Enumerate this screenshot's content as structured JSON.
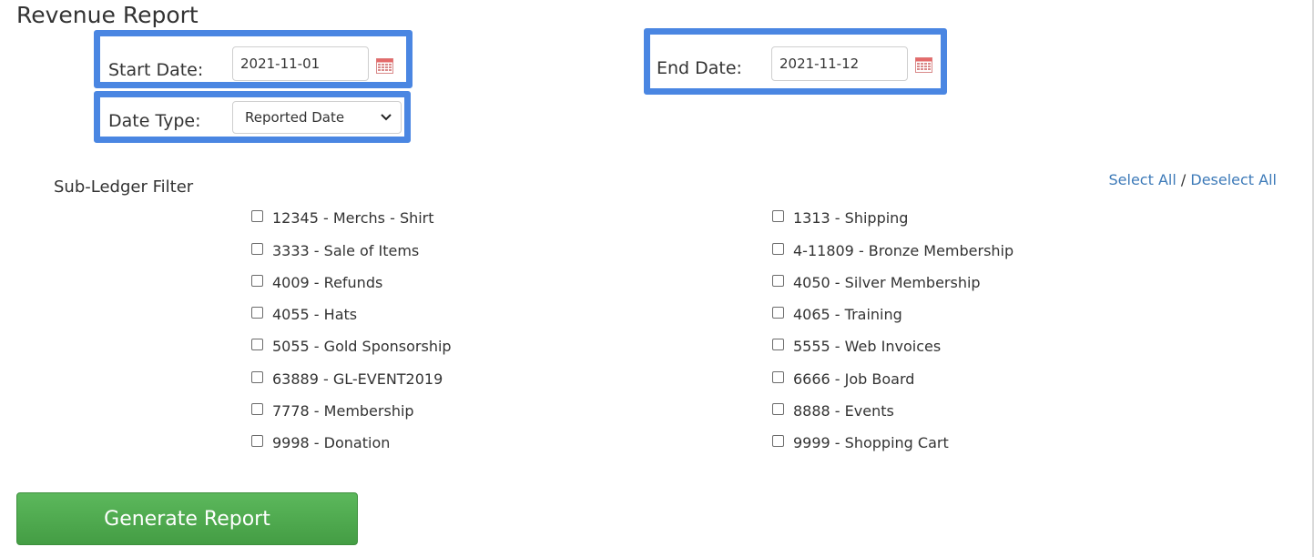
{
  "page": {
    "title": "Revenue Report"
  },
  "filters": {
    "start_date": {
      "label": "Start Date:",
      "value": "2021-11-01"
    },
    "end_date": {
      "label": "End Date:",
      "value": "2021-11-12"
    },
    "date_type": {
      "label": "Date Type:",
      "selected": "Reported Date"
    }
  },
  "subledger": {
    "title": "Sub-Ledger Filter",
    "select_all": "Select All",
    "separator": "/",
    "deselect_all": "Deselect All",
    "left": [
      "12345 - Merchs - Shirt",
      "3333 - Sale of Items",
      "4009 - Refunds",
      "4055 - Hats",
      "5055 - Gold Sponsorship",
      "63889 - GL-EVENT2019",
      "7778 - Membership",
      "9998 - Donation"
    ],
    "right": [
      "1313 - Shipping",
      "4-11809 - Bronze Membership",
      "4050 - Silver Membership",
      "4065 - Training",
      "5555 - Web Invoices",
      "6666 - Job Board",
      "8888 - Events",
      "9999 - Shopping Cart"
    ]
  },
  "actions": {
    "generate": "Generate Report"
  },
  "icons": {
    "calendar": "calendar-icon",
    "dropdown": "chevron-down-icon"
  },
  "colors": {
    "highlight": "#4a86e2",
    "primary_button": "#5cb85c",
    "link": "#3d7ab8"
  }
}
